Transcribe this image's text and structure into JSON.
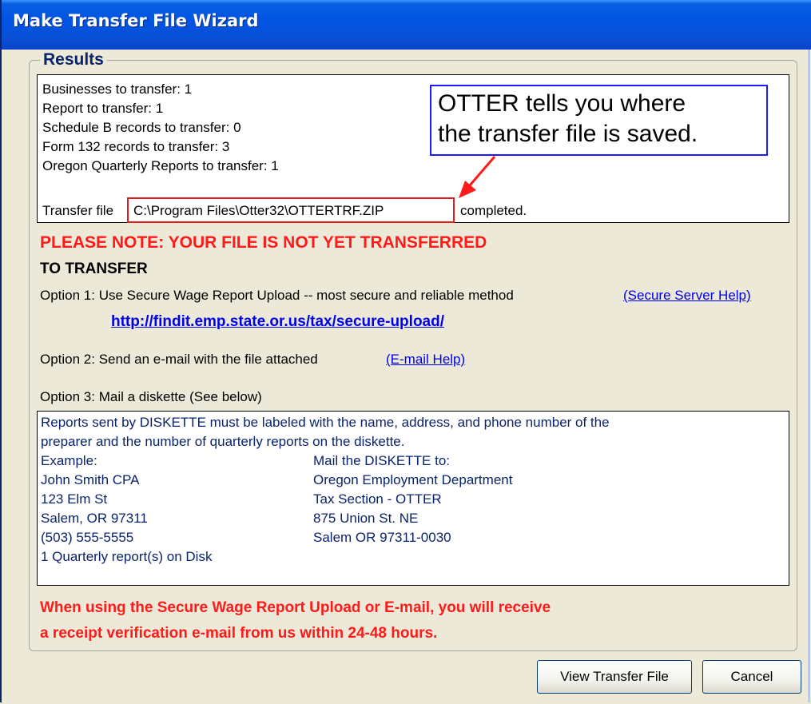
{
  "window": {
    "title": "Make Transfer File Wizard"
  },
  "results": {
    "label": "Results",
    "lines": [
      "Businesses to transfer: 1",
      "Report to transfer: 1",
      "Schedule B records to transfer: 0",
      "Form 132 records to transfer: 3",
      "Oregon Quarterly Reports to transfer: 1"
    ],
    "transfer_prefix": "Transfer file",
    "transfer_path": "C:\\Program Files\\Otter32\\OTTERTRF.ZIP",
    "transfer_suffix": "completed."
  },
  "callout": {
    "line1": "OTTER tells you where",
    "line2": "the transfer file is saved."
  },
  "notice": {
    "warning": "PLEASE NOTE: YOUR FILE IS NOT YET TRANSFERRED",
    "heading": "TO TRANSFER"
  },
  "options": {
    "option1_text": "Option 1: Use Secure Wage Report Upload -- most secure and reliable method",
    "option1_help": "(Secure Server Help)",
    "option1_url": "http://findit.emp.state.or.us/tax/secure-upload/",
    "option2_text": "Option 2: Send an e-mail with the file attached",
    "option2_help": "(E-mail Help)",
    "option3_text": "Option 3: Mail a diskette (See below)"
  },
  "diskette": {
    "intro1": "Reports sent by DISKETTE must be labeled with the name, address, and phone number of the",
    "intro2": "preparer and the number of quarterly reports on the diskette.",
    "example_lines": [
      "Example:",
      "John Smith CPA",
      "123 Elm St",
      "Salem, OR 97311",
      "(503) 555-5555",
      "1 Quarterly report(s) on Disk"
    ],
    "mail_lines": [
      "Mail the DISKETTE to:",
      "Oregon Employment Department",
      "Tax Section - OTTER",
      "875 Union St. NE",
      "Salem OR 97311-0030"
    ]
  },
  "receipt": {
    "line1": "When using the Secure Wage Report Upload or E-mail, you will receive",
    "line2": "a receipt verification e-mail from us within 24-48 hours."
  },
  "buttons": {
    "view": "View Transfer File",
    "cancel": "Cancel"
  },
  "colors": {
    "title_bar": "#0054e3",
    "warning_red": "#ff1a1a",
    "link_blue": "#0000ee",
    "callout_border": "#1a1aff",
    "highlight_red": "#e31b1b"
  }
}
